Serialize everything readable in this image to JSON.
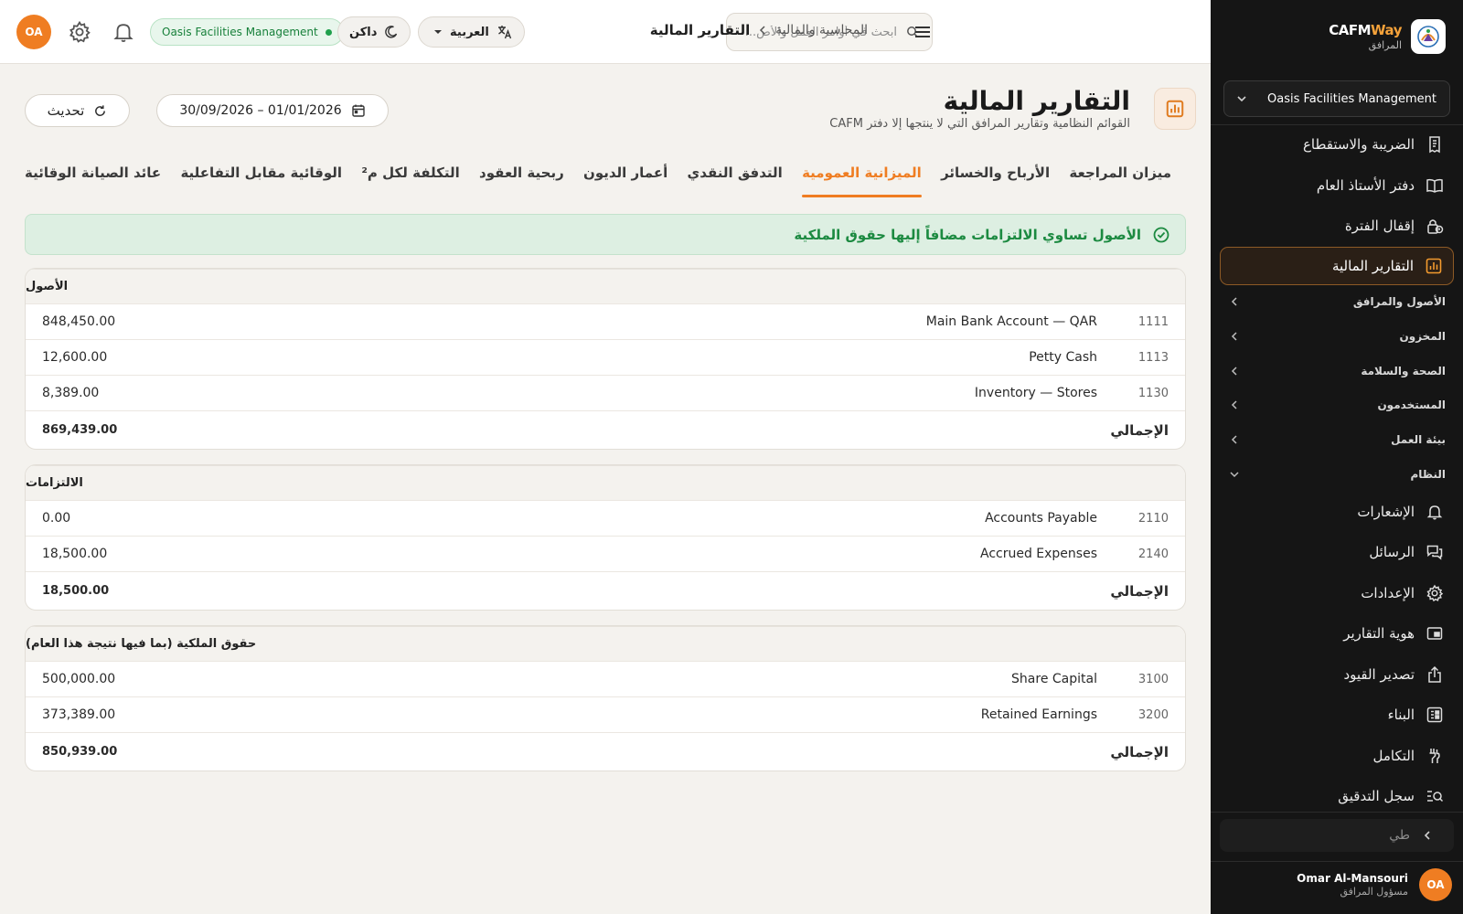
{
  "brand": {
    "name_main": "CAFM",
    "name_accent": "Way",
    "subtitle": "المرافق"
  },
  "sidebar": {
    "org_select": "Oasis Facilities Management",
    "items_top": [
      {
        "label": "الضريبة والاستقطاع",
        "icon": "receipt-icon"
      },
      {
        "label": "دفتر الأستاذ العام",
        "icon": "book-icon"
      },
      {
        "label": "إقفال الفترة",
        "icon": "lock-clock-icon"
      },
      {
        "label": "التقارير المالية",
        "icon": "bar-chart-icon",
        "active": true
      }
    ],
    "groups": [
      {
        "label": "الأصول والمرافق"
      },
      {
        "label": "المخزون"
      },
      {
        "label": "الصحة والسلامة"
      },
      {
        "label": "المستخدمون"
      },
      {
        "label": "بيئة العمل"
      },
      {
        "label": "النظام",
        "expanded": true
      }
    ],
    "items_system": [
      {
        "label": "الإشعارات",
        "icon": "bell-icon"
      },
      {
        "label": "الرسائل",
        "icon": "chat-icon"
      },
      {
        "label": "الإعدادات",
        "icon": "gear-icon"
      },
      {
        "label": "هوية التقارير",
        "icon": "branding-icon"
      },
      {
        "label": "تصدير القيود",
        "icon": "export-icon"
      },
      {
        "label": "البناء",
        "icon": "builder-icon"
      },
      {
        "label": "التكامل",
        "icon": "integration-icon"
      },
      {
        "label": "سجل التدقيق",
        "icon": "audit-search-icon"
      }
    ],
    "collapse_label": "طي",
    "user": {
      "name": "Omar Al-Mansouri",
      "role": "مسؤول المرافق",
      "initials": "OA"
    }
  },
  "topbar": {
    "avatar_initials": "OA",
    "org_pill": "Oasis Facilities Management",
    "theme_label": "داكن",
    "lang_label": "العربية",
    "search_placeholder": "ابحث في أوامر العمل والأص...",
    "breadcrumb_parent": "المحاسبة والمالية",
    "breadcrumb_current": "التقارير المالية"
  },
  "page": {
    "title": "التقارير المالية",
    "subtitle": "القوائم النظامية وتقارير المرافق التي لا ينتجها إلا دفتر CAFM",
    "date_range": "30/09/2026 – 01/01/2026",
    "refresh_label": "تحديث"
  },
  "tabs": [
    {
      "label": "ميزان المراجعة"
    },
    {
      "label": "الأرباح والخسائر"
    },
    {
      "label": "الميزانية العمومية",
      "active": true
    },
    {
      "label": "التدفق النقدي"
    },
    {
      "label": "أعمار الديون"
    },
    {
      "label": "ربحية العقود"
    },
    {
      "label": "التكلفة لكل م²"
    },
    {
      "label": "الوقائية مقابل التفاعلية"
    },
    {
      "label": "عائد الصيانة الوقائية"
    }
  ],
  "banner": "الأصول تساوي الالتزامات مضافاً إليها حقوق الملكية",
  "sections": [
    {
      "title": "الأصول",
      "rows": [
        {
          "code": "1111",
          "name": "Main Bank Account — QAR",
          "amount": "848,450.00"
        },
        {
          "code": "1113",
          "name": "Petty Cash",
          "amount": "12,600.00"
        },
        {
          "code": "1130",
          "name": "Inventory — Stores",
          "amount": "8,389.00"
        }
      ],
      "total_label": "الإجمالي",
      "total": "869,439.00"
    },
    {
      "title": "الالتزامات",
      "rows": [
        {
          "code": "2110",
          "name": "Accounts Payable",
          "amount": "0.00"
        },
        {
          "code": "2140",
          "name": "Accrued Expenses",
          "amount": "18,500.00"
        }
      ],
      "total_label": "الإجمالي",
      "total": "18,500.00"
    },
    {
      "title": "حقوق الملكية (بما فيها نتيجة هذا العام)",
      "rows": [
        {
          "code": "3100",
          "name": "Share Capital",
          "amount": "500,000.00"
        },
        {
          "code": "3200",
          "name": "Retained Earnings",
          "amount": "373,389.00"
        }
      ],
      "total_label": "الإجمالي",
      "total": "850,939.00"
    }
  ],
  "colors": {
    "accent": "#ef7d22",
    "success": "#1c8a41",
    "sidebar_bg": "#151515"
  }
}
